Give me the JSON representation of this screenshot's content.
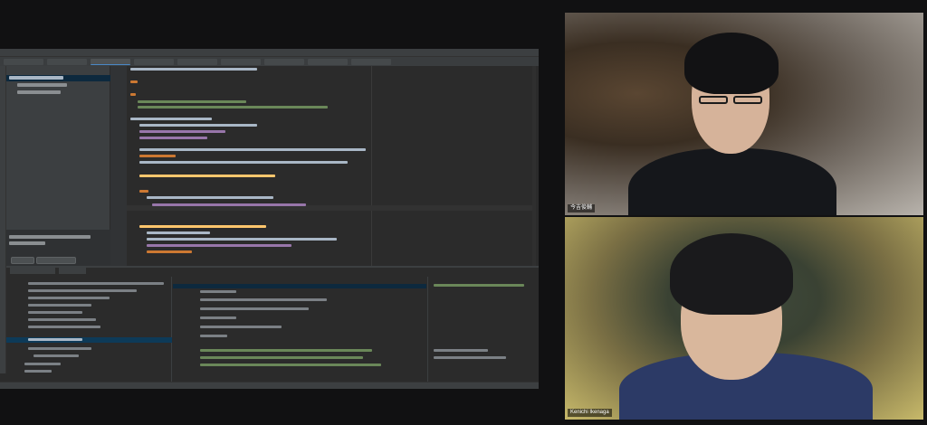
{
  "participants": [
    {
      "name": "今吉俊輔"
    },
    {
      "name": "Kenichi Ikenaga"
    }
  ],
  "colors": {
    "background": "#111112",
    "ide_background": "#2b2b2b",
    "ide_panel": "#3c3f41",
    "selection": "#0d293e",
    "accent": "#4a88c7"
  }
}
